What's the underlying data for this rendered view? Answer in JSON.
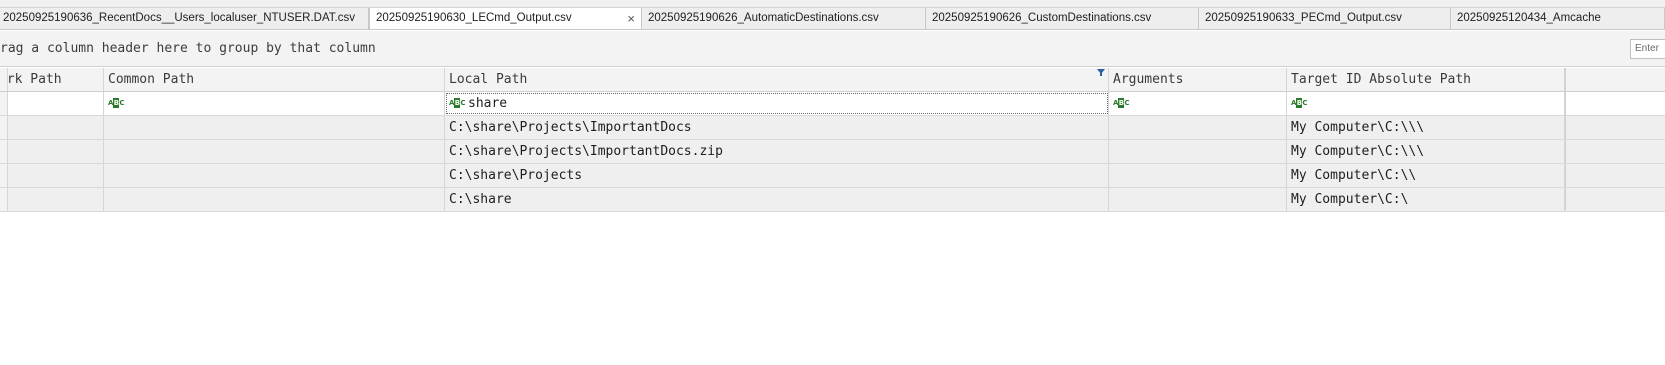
{
  "tabs": [
    {
      "label": "20250925190636_RecentDocs__Users_localuser_NTUSER.DAT.csv",
      "active": false
    },
    {
      "label": "20250925190630_LECmd_Output.csv",
      "active": true,
      "close": "×"
    },
    {
      "label": "20250925190626_AutomaticDestinations.csv",
      "active": false
    },
    {
      "label": "20250925190626_CustomDestinations.csv",
      "active": false
    },
    {
      "label": "20250925190633_PECmd_Output.csv",
      "active": false
    },
    {
      "label": "20250925120434_Amcache",
      "active": false
    }
  ],
  "group_panel": {
    "hint": "rag a column header here to group by that column",
    "find_placeholder": "Enter"
  },
  "columns": [
    {
      "label": "ork Path"
    },
    {
      "label": "Common Path"
    },
    {
      "label": "Local Path",
      "filtered": true
    },
    {
      "label": "Arguments"
    },
    {
      "label": "Target ID Absolute Path"
    }
  ],
  "filter_row": {
    "local_path": "share",
    "icon": "text-filter-icon"
  },
  "rows": [
    {
      "network_path": "",
      "common_path": "",
      "local_path": "C:\\share\\Projects\\ImportantDocs",
      "arguments": "",
      "target_id_absolute_path": "My Computer\\C:\\\\\\"
    },
    {
      "network_path": "",
      "common_path": "",
      "local_path": "C:\\share\\Projects\\ImportantDocs.zip",
      "arguments": "",
      "target_id_absolute_path": "My Computer\\C:\\\\\\"
    },
    {
      "network_path": "",
      "common_path": "",
      "local_path": "C:\\share\\Projects",
      "arguments": "",
      "target_id_absolute_path": "My Computer\\C:\\\\"
    },
    {
      "network_path": "",
      "common_path": "",
      "local_path": "C:\\share",
      "arguments": "",
      "target_id_absolute_path": "My Computer\\C:\\"
    }
  ],
  "colors": {
    "filter_icon": "#2b7a2b",
    "active_filter": "#2a5fa8",
    "row_bg": "#efefef"
  }
}
